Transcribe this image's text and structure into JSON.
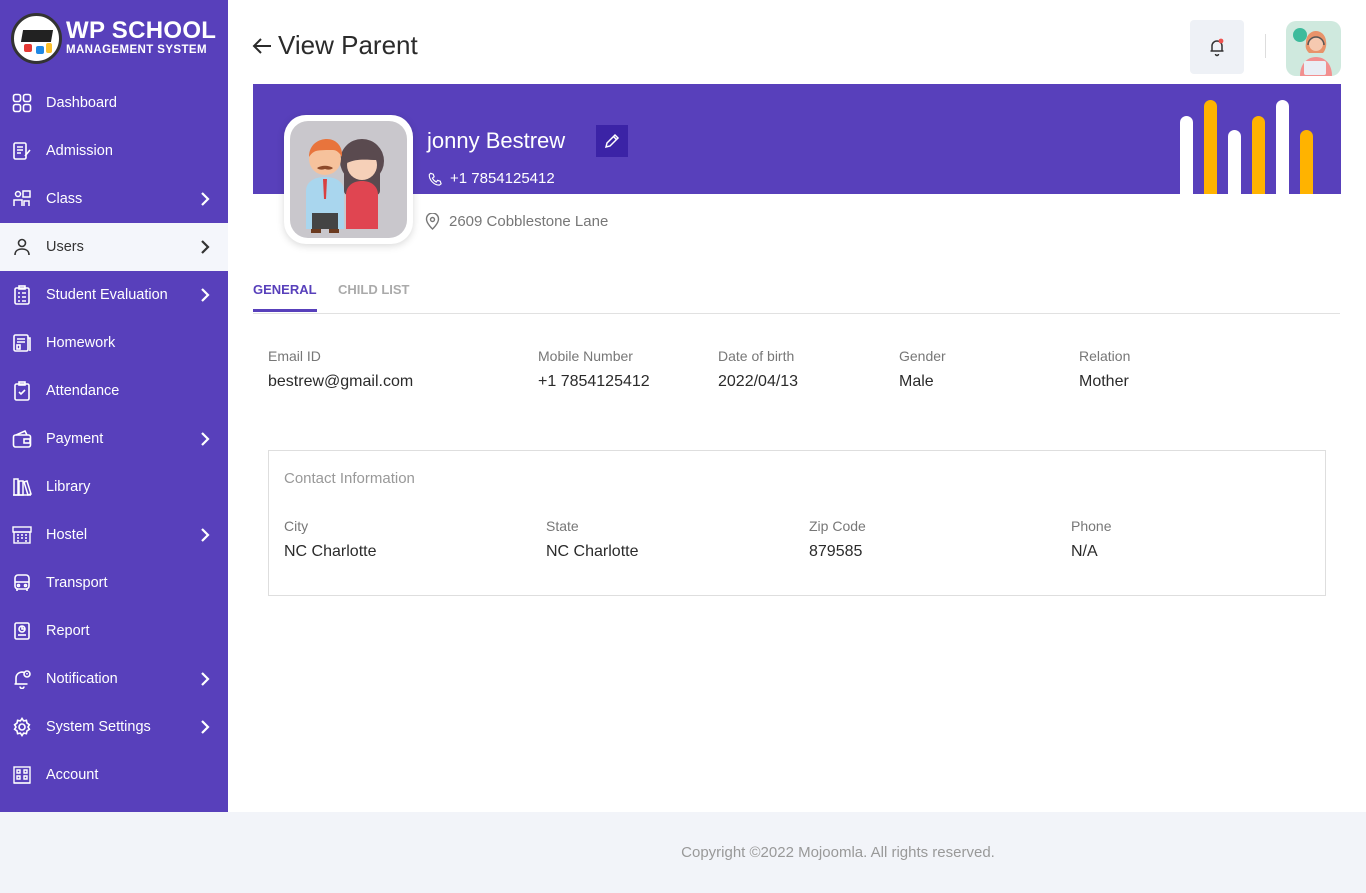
{
  "brand": {
    "title": "WP SCHOOL",
    "subtitle": "MANAGEMENT SYSTEM"
  },
  "sidebar": {
    "items": [
      {
        "label": "Dashboard",
        "icon": "dashboard-icon",
        "has_submenu": false,
        "active": false
      },
      {
        "label": "Admission",
        "icon": "admission-icon",
        "has_submenu": false,
        "active": false
      },
      {
        "label": "Class",
        "icon": "class-icon",
        "has_submenu": true,
        "active": false
      },
      {
        "label": "Users",
        "icon": "user-icon",
        "has_submenu": true,
        "active": true
      },
      {
        "label": "Student Evaluation",
        "icon": "evaluation-icon",
        "has_submenu": true,
        "active": false
      },
      {
        "label": "Homework",
        "icon": "homework-icon",
        "has_submenu": false,
        "active": false
      },
      {
        "label": "Attendance",
        "icon": "attendance-icon",
        "has_submenu": false,
        "active": false
      },
      {
        "label": "Payment",
        "icon": "wallet-icon",
        "has_submenu": true,
        "active": false
      },
      {
        "label": "Library",
        "icon": "library-icon",
        "has_submenu": false,
        "active": false
      },
      {
        "label": "Hostel",
        "icon": "hostel-icon",
        "has_submenu": true,
        "active": false
      },
      {
        "label": "Transport",
        "icon": "bus-icon",
        "has_submenu": false,
        "active": false
      },
      {
        "label": "Report",
        "icon": "report-icon",
        "has_submenu": false,
        "active": false
      },
      {
        "label": "Notification",
        "icon": "notification-icon",
        "has_submenu": true,
        "active": false
      },
      {
        "label": "System Settings",
        "icon": "gear-icon",
        "has_submenu": true,
        "active": false
      },
      {
        "label": "Account",
        "icon": "account-icon",
        "has_submenu": false,
        "active": false
      }
    ]
  },
  "header": {
    "page_title": "View Parent"
  },
  "profile": {
    "name": "jonny Bestrew",
    "phone": "+1  7854125412",
    "address": "2609 Cobblestone Lane"
  },
  "tabs": {
    "general": "GENERAL",
    "child_list": "CHILD LIST"
  },
  "details": {
    "email_label": "Email ID",
    "email_value": "bestrew@gmail.com",
    "mobile_label": "Mobile Number",
    "mobile_value": "+1  7854125412",
    "dob_label": "Date of birth",
    "dob_value": "2022/04/13",
    "gender_label": "Gender",
    "gender_value": "Male",
    "relation_label": "Relation",
    "relation_value": "Mother"
  },
  "contact": {
    "title": "Contact Information",
    "city_label": "City",
    "city_value": "NC Charlotte",
    "state_label": "State",
    "state_value": "NC Charlotte",
    "zip_label": "Zip Code",
    "zip_value": "879585",
    "phone_label": "Phone",
    "phone_value": "N/A"
  },
  "footer": {
    "copyright": "Copyright ©2022 Mojoomla. All rights reserved."
  },
  "colors": {
    "primary": "#5840bb",
    "accent_dark": "#3b23a6",
    "bar_white": "#ffffff",
    "bar_yellow": "#ffb300",
    "notification_dot": "#ef5350"
  }
}
